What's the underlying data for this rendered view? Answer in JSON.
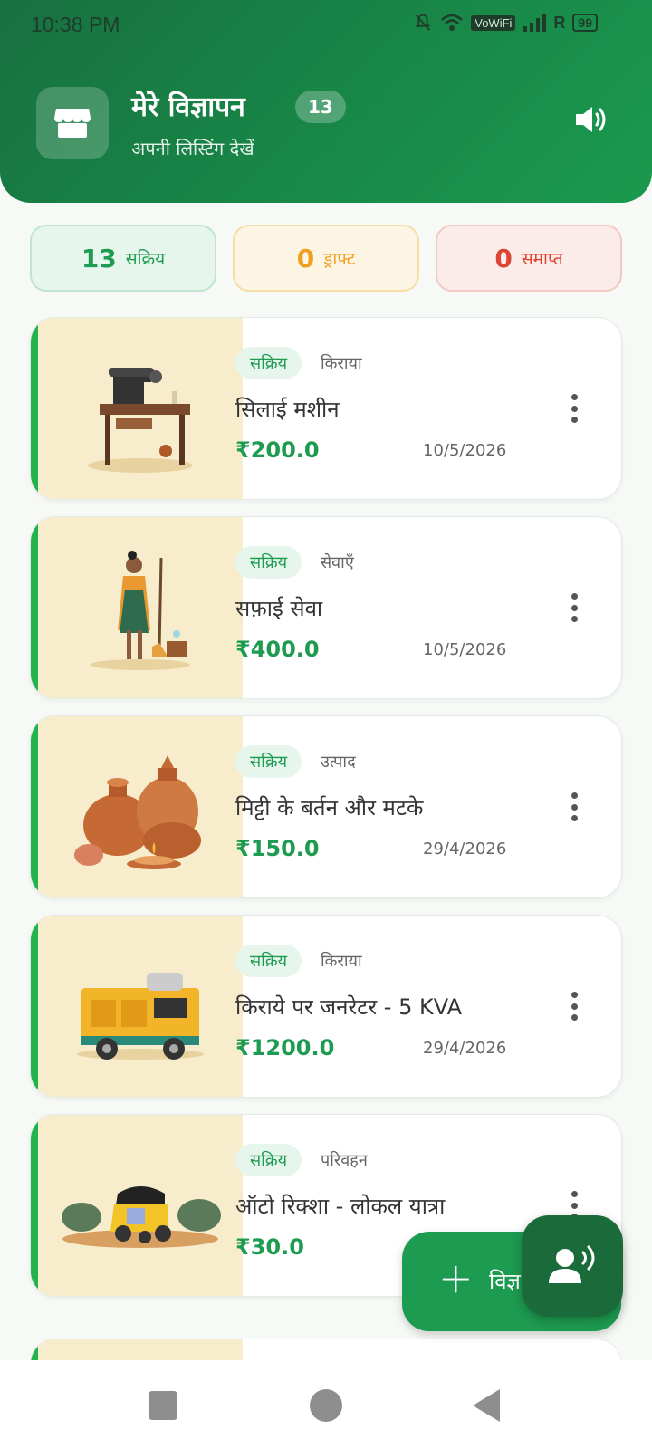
{
  "status_bar": {
    "time": "10:38 PM",
    "vowifi": "VoWiFi",
    "roaming": "R",
    "battery": "99"
  },
  "header": {
    "title": "मेरे विज्ञापन",
    "count": "13",
    "subtitle": "अपनी लिस्टिंग देखें",
    "icon": "store-icon",
    "speaker_icon": "speaker-icon"
  },
  "tabs": [
    {
      "count": "13",
      "label": "सक्रिय",
      "color": "#1d9b50"
    },
    {
      "count": "0",
      "label": "ड्राफ़्ट",
      "color": "#f0a020"
    },
    {
      "count": "0",
      "label": "समाप्त",
      "color": "#dc4433"
    }
  ],
  "listings": [
    {
      "status": "सक्रिय",
      "category": "किराया",
      "title": "सिलाई मशीन",
      "price": "₹200.0",
      "date": "10/5/2026",
      "image": "sewing-machine"
    },
    {
      "status": "सक्रिय",
      "category": "सेवाएँ",
      "title": "सफ़ाई सेवा",
      "price": "₹400.0",
      "date": "10/5/2026",
      "image": "cleaning-woman"
    },
    {
      "status": "सक्रिय",
      "category": "उत्पाद",
      "title": "मिट्टी के बर्तन और मटके",
      "price": "₹150.0",
      "date": "29/4/2026",
      "image": "clay-pots"
    },
    {
      "status": "सक्रिय",
      "category": "किराया",
      "title": "किराये पर जनरेटर - 5 KVA",
      "price": "₹1200.0",
      "date": "29/4/2026",
      "image": "generator"
    },
    {
      "status": "सक्रिय",
      "category": "परिवहन",
      "title": "ऑटो रिक्शा - लोकल यात्रा",
      "price": "₹30.0",
      "date": "",
      "image": "auto-rickshaw"
    }
  ],
  "fab": {
    "label": "विज्ञ",
    "icon": "plus-icon",
    "voice_icon": "voice-assistant-icon"
  },
  "colors": {
    "primary": "#1d9b50",
    "header_dark": "#17713f",
    "accent_bar": "#22b34f",
    "thumb_bg": "#f7eccb"
  }
}
